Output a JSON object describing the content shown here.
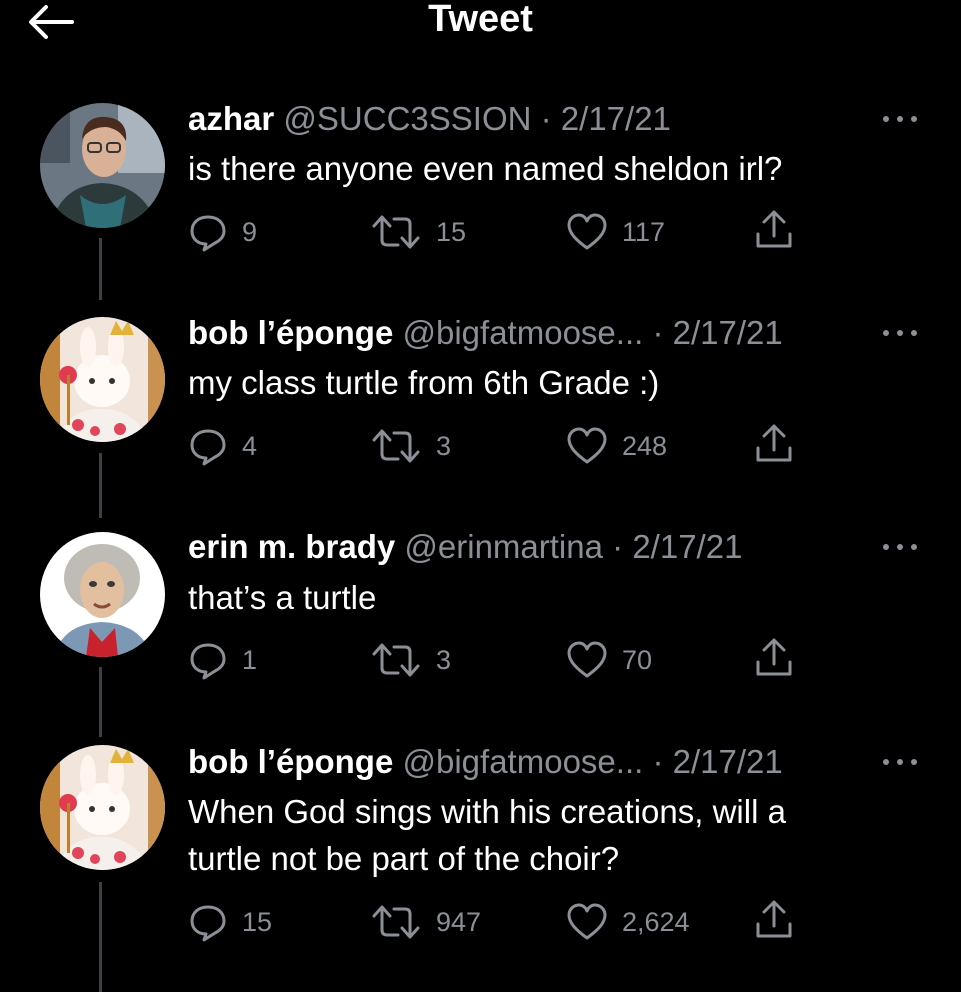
{
  "header": {
    "title": "Tweet"
  },
  "tweets": [
    {
      "name": "azhar",
      "handle": "@SUCC3SSION",
      "separator": "·",
      "date": "2/17/21",
      "text_lines": [
        "is there anyone even named sheldon irl?"
      ],
      "replies": "9",
      "retweets": "15",
      "likes": "117"
    },
    {
      "name": "bob l’éponge",
      "handle": "@bigfatmoose...",
      "separator": "·",
      "date": "2/17/21",
      "text_lines": [
        "my class turtle from 6th Grade :)"
      ],
      "replies": "4",
      "retweets": "3",
      "likes": "248"
    },
    {
      "name": "erin m. brady",
      "handle": "@erinmartina",
      "separator": "·",
      "date": "2/17/21",
      "text_lines": [
        "that’s a turtle"
      ],
      "replies": "1",
      "retweets": "3",
      "likes": "70"
    },
    {
      "name": "bob l’éponge",
      "handle": "@bigfatmoose...",
      "separator": "·",
      "date": "2/17/21",
      "text_lines": [
        "When God sings with his creations, will a",
        "turtle not be part of the choir?"
      ],
      "replies": "15",
      "retweets": "947",
      "likes": "2,624"
    }
  ],
  "icons": {
    "back": "arrow-left-icon",
    "more": "more-horizontal-icon",
    "reply": "reply-bubble-icon",
    "retweet": "retweet-icon",
    "like": "heart-icon",
    "share": "share-upload-icon"
  },
  "colors": {
    "background": "#000000",
    "text_primary": "#ffffff",
    "text_secondary": "#8b9096",
    "thread_line": "#3e4144"
  }
}
